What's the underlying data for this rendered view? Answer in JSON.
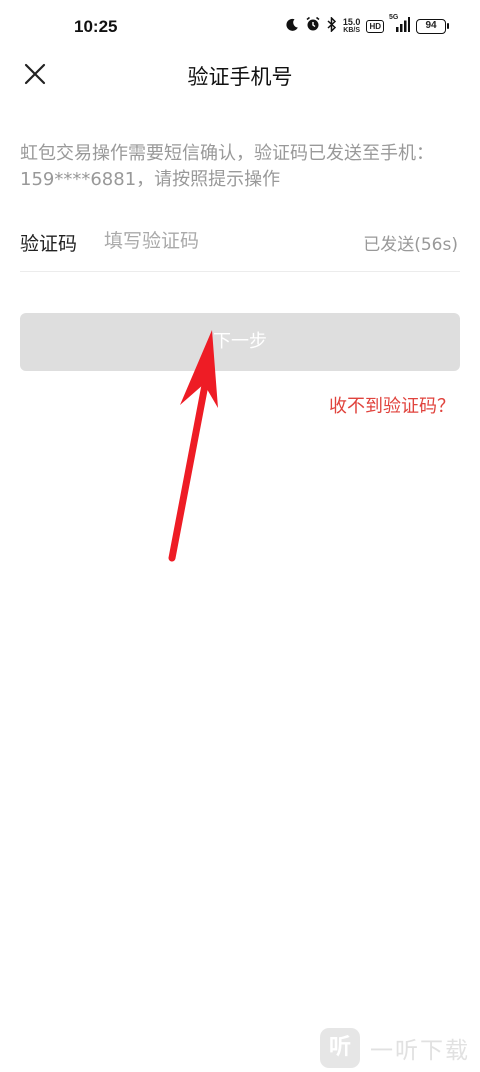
{
  "status_bar": {
    "time": "10:25",
    "net_speed_value": "15.0",
    "net_speed_unit": "KB/S",
    "hd_label": "HD",
    "network_label": "5G",
    "battery": "94",
    "icons": [
      "moon-icon",
      "alarm-icon",
      "bluetooth-icon",
      "signal-icon"
    ]
  },
  "header": {
    "title": "验证手机号",
    "close_icon": "close-icon"
  },
  "main": {
    "description": "虹包交易操作需要短信确认，验证码已发送至手机：159****6881，请按照提示操作",
    "code_field": {
      "label": "验证码",
      "value": "",
      "placeholder": "填写验证码",
      "resend_status": "已发送(56s)"
    },
    "next_button_label": "下一步",
    "no_code_link": "收不到验证码？"
  },
  "annotation": {
    "arrow_color": "#ee1c25"
  },
  "watermark": {
    "logo_text": "听",
    "text": "一听下载"
  },
  "colors": {
    "link_red": "#e0433d",
    "button_disabled_bg": "#dedede",
    "hint_gray": "#999999"
  }
}
